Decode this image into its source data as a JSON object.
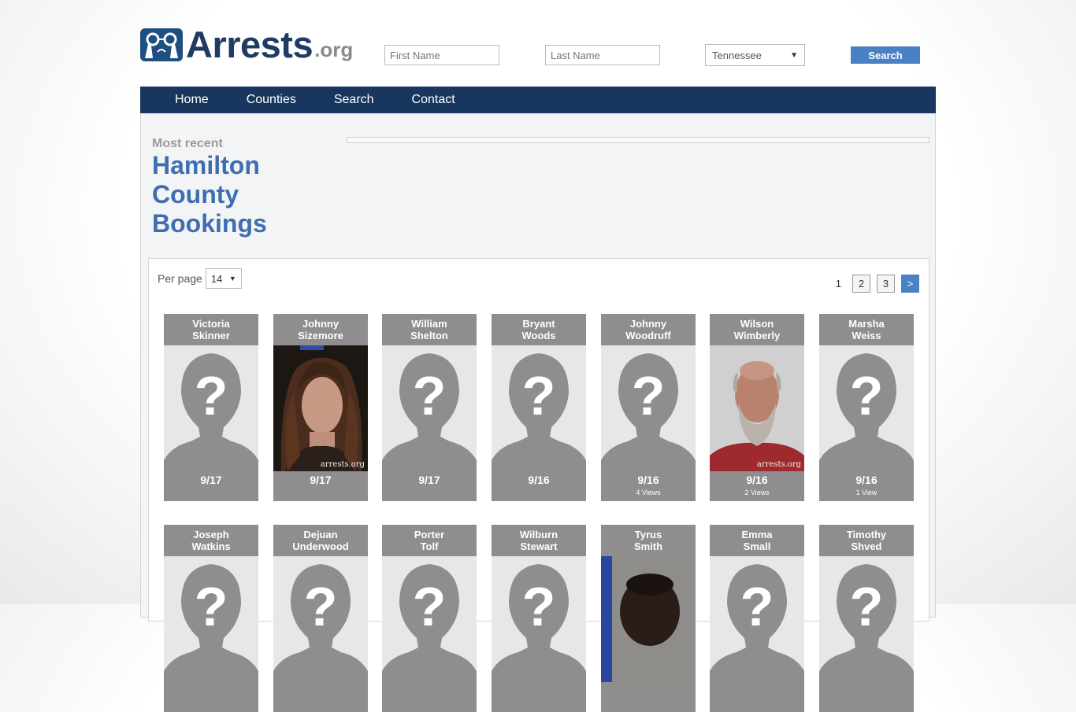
{
  "logo": {
    "name": "Arrests",
    "tld": ".org"
  },
  "search": {
    "first_placeholder": "First Name",
    "last_placeholder": "Last Name",
    "state": "Tennessee",
    "button": "Search"
  },
  "nav": [
    "Home",
    "Counties",
    "Search",
    "Contact"
  ],
  "page": {
    "kicker": "Most recent",
    "title_lines": [
      "Hamilton",
      "County",
      "Bookings"
    ]
  },
  "listing": {
    "per_page_label": "Per page",
    "per_page_value": "14",
    "pages": [
      "1",
      "2",
      "3"
    ],
    "next": ">"
  },
  "colors": {
    "brand": "#17375e",
    "accent": "#4a81c4",
    "title": "#3f6eb0",
    "card": "#8f8d8d"
  },
  "people": [
    {
      "first": "Victoria",
      "last": "Skinner",
      "date": "9/17",
      "views": "",
      "photo": "placeholder"
    },
    {
      "first": "Johnny",
      "last": "Sizemore",
      "date": "9/17",
      "views": "",
      "photo": "mugshot-long-hair"
    },
    {
      "first": "William",
      "last": "Shelton",
      "date": "9/17",
      "views": "",
      "photo": "placeholder"
    },
    {
      "first": "Bryant",
      "last": "Woods",
      "date": "9/16",
      "views": "",
      "photo": "placeholder"
    },
    {
      "first": "Johnny",
      "last": "Woodruff",
      "date": "9/16",
      "views": "4 Views",
      "photo": "placeholder"
    },
    {
      "first": "Wilson",
      "last": "Wimberly",
      "date": "9/16",
      "views": "2 Views",
      "photo": "mugshot-bald-beard"
    },
    {
      "first": "Marsha",
      "last": "Weiss",
      "date": "9/16",
      "views": "1 View",
      "photo": "placeholder"
    },
    {
      "first": "Joseph",
      "last": "Watkins",
      "date": "",
      "views": "",
      "photo": "placeholder"
    },
    {
      "first": "Dejuan",
      "last": "Underwood",
      "date": "",
      "views": "",
      "photo": "placeholder"
    },
    {
      "first": "Porter",
      "last": "Tolf",
      "date": "",
      "views": "",
      "photo": "placeholder"
    },
    {
      "first": "Wilburn",
      "last": "Stewart",
      "date": "",
      "views": "",
      "photo": "placeholder"
    },
    {
      "first": "Tyrus",
      "last": "Smith",
      "date": "",
      "views": "",
      "photo": "mugshot-dark"
    },
    {
      "first": "Emma",
      "last": "Small",
      "date": "",
      "views": "",
      "photo": "placeholder"
    },
    {
      "first": "Timothy",
      "last": "Shved",
      "date": "",
      "views": "",
      "photo": "placeholder"
    }
  ],
  "watermark": "arrests.org"
}
